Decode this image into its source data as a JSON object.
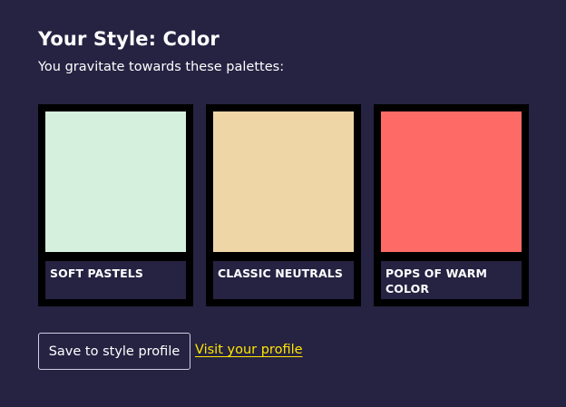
{
  "header": {
    "title": "Your Style: Color",
    "subtitle": "You gravitate towards these palettes:"
  },
  "palettes": [
    {
      "label": "SOFT PASTELS",
      "color": "#d5f0dc"
    },
    {
      "label": "CLASSIC NEUTRALS",
      "color": "#efd6a7"
    },
    {
      "label": "POPS OF WARM COLOR",
      "color": "#fe6b66"
    }
  ],
  "actions": {
    "save_label": "Save to style profile",
    "profile_link_label": "Visit your profile"
  },
  "theme": {
    "background": "#262242",
    "card_frame": "#000000",
    "link_color": "#ffe600",
    "text_color": "#ffffff"
  }
}
